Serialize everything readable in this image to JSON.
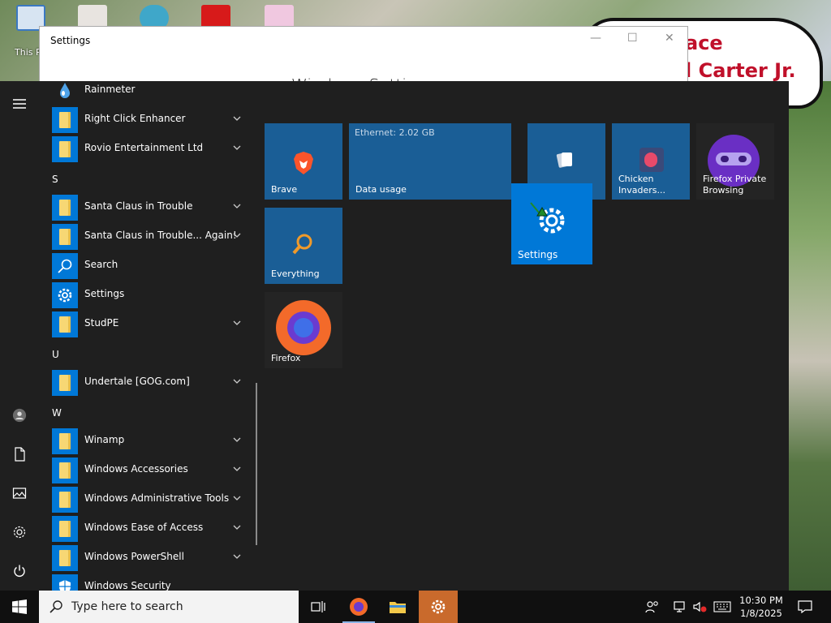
{
  "desktop": {
    "icon_label": "This PC",
    "sign_text": "ace\nl Carter Jr."
  },
  "settings_window": {
    "title": "Settings",
    "heading": "Windows Settings",
    "minimize": "—",
    "maximize": "☐",
    "close": "✕"
  },
  "start_menu": {
    "apps": [
      {
        "label": "Rainmeter",
        "icon": "rainmeter-icon",
        "expandable": false
      },
      {
        "label": "Right Click Enhancer",
        "icon": "folder-icon",
        "expandable": true
      },
      {
        "label": "Rovio Entertainment Ltd",
        "icon": "folder-icon",
        "expandable": true
      },
      {
        "letter": "S"
      },
      {
        "label": "Santa Claus in Trouble",
        "icon": "folder-icon",
        "expandable": true
      },
      {
        "label": "Santa Claus in Trouble... Again!",
        "icon": "folder-icon",
        "expandable": true
      },
      {
        "label": "Search",
        "icon": "search-icon",
        "expandable": false
      },
      {
        "label": "Settings",
        "icon": "gear-icon",
        "expandable": false
      },
      {
        "label": "StudPE",
        "icon": "folder-icon",
        "expandable": true
      },
      {
        "letter": "U"
      },
      {
        "label": "Undertale [GOG.com]",
        "icon": "folder-icon",
        "expandable": true
      },
      {
        "letter": "W"
      },
      {
        "label": "Winamp",
        "icon": "folder-icon",
        "expandable": true
      },
      {
        "label": "Windows Accessories",
        "icon": "folder-icon",
        "expandable": true
      },
      {
        "label": "Windows Administrative Tools",
        "icon": "folder-icon",
        "expandable": true
      },
      {
        "label": "Windows Ease of Access",
        "icon": "folder-icon",
        "expandable": true
      },
      {
        "label": "Windows PowerShell",
        "icon": "folder-icon",
        "expandable": true
      },
      {
        "label": "Windows Security",
        "icon": "shield-icon",
        "expandable": false
      }
    ],
    "tiles": {
      "brave": "Brave",
      "data_usage_sub": "Ethernet: 2.02 GB",
      "data_usage": "Data usage",
      "solitaire": "",
      "chicken_line1": "Chicken",
      "chicken_line2": "Invaders...",
      "firefox_private_line1": "Firefox Private",
      "firefox_private_line2": "Browsing",
      "everything": "Everything",
      "firefox": "Firefox",
      "settings_dragged": "Settings"
    }
  },
  "taskbar": {
    "search_placeholder": "Type here to search",
    "time": "10:30 PM",
    "date": "1/8/2025"
  },
  "colors": {
    "accent": "#0078d7",
    "tile": "#1a5e96",
    "start_bg": "#1f1f1f",
    "taskbar_bg": "#101010"
  }
}
